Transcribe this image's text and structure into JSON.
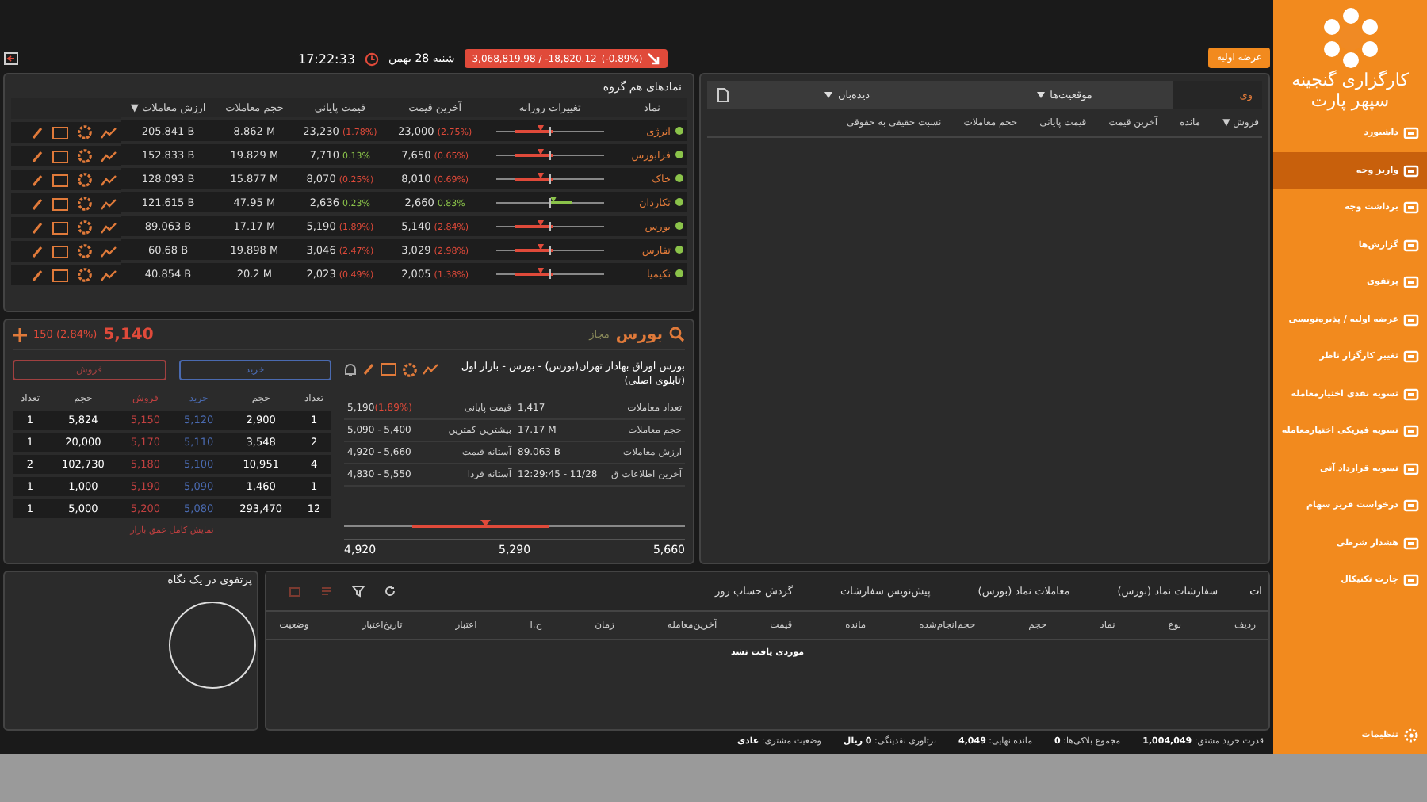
{
  "top_bar": {
    "index": {
      "value": "3,068,819.98 / -18,820.12",
      "pct": "(-0.89%)",
      "up": false
    },
    "date": "شنبه 28 بهمن",
    "time": "17:22:33"
  },
  "ipo_button": "عرضه اولیه",
  "group_table": {
    "title": "نمادهای هم گروه",
    "columns": [
      "نماد",
      "تغییرات روزانه",
      "آخرین قیمت",
      "قیمت پایانی",
      "حجم معاملات",
      "ارزش معاملات ▼"
    ],
    "rows": [
      {
        "symbol": "انرژی",
        "last": "23,000",
        "last_pct": "(2.75%)",
        "last_up": false,
        "close": "23,230",
        "close_pct": "(1.78%)",
        "close_up": false,
        "volume": "8.862 M",
        "value": "205.841 B"
      },
      {
        "symbol": "فرابورس",
        "last": "7,650",
        "last_pct": "(0.65%)",
        "last_up": false,
        "close": "7,710",
        "close_pct": "0.13%",
        "close_up": true,
        "volume": "19.829 M",
        "value": "152.833 B"
      },
      {
        "symbol": "خاک",
        "last": "8,010",
        "last_pct": "(0.69%)",
        "last_up": false,
        "close": "8,070",
        "close_pct": "(0.25%)",
        "close_up": false,
        "volume": "15.877 M",
        "value": "128.093 B"
      },
      {
        "symbol": "تکاردان",
        "last": "2,660",
        "last_pct": "0.83%",
        "last_up": true,
        "close": "2,636",
        "close_pct": "0.23%",
        "close_up": true,
        "volume": "47.95 M",
        "value": "121.615 B"
      },
      {
        "symbol": "بورس",
        "last": "5,140",
        "last_pct": "(2.84%)",
        "last_up": false,
        "close": "5,190",
        "close_pct": "(1.89%)",
        "close_up": false,
        "volume": "17.17 M",
        "value": "89.063 B"
      },
      {
        "symbol": "تفارس",
        "last": "3,029",
        "last_pct": "(2.98%)",
        "last_up": false,
        "close": "3,046",
        "close_pct": "(2.47%)",
        "close_up": false,
        "volume": "19.898 M",
        "value": "60.68 B"
      },
      {
        "symbol": "تکیمیا",
        "last": "2,005",
        "last_pct": "(1.38%)",
        "last_up": false,
        "close": "2,023",
        "close_pct": "(0.49%)",
        "close_up": false,
        "volume": "20.2 M",
        "value": "40.854 B"
      }
    ]
  },
  "symbol_panel": {
    "symbol": "بورس",
    "status": "مجاز",
    "price": "5,140",
    "change": "150 (2.84%)",
    "up": false,
    "full_name": "بورس اوراق بهادار تهران(بورس) - بورس - بازار اول (تابلوی اصلی)",
    "buy_button": "خرید",
    "sell_button": "فروش",
    "info": [
      {
        "label": "تعداد معاملات",
        "value": "1,417"
      },
      {
        "label": "قیمت پایانی",
        "value": "5,190",
        "pct": "(1.89%)"
      },
      {
        "label": "حجم معاملات",
        "value": "17.17 M"
      },
      {
        "label": "بیشترین کمترین",
        "value": "5,090 - 5,400"
      },
      {
        "label": "ارزش معاملات",
        "value": "89.063 B"
      },
      {
        "label": "آستانه قیمت",
        "value": "4,920 - 5,660"
      },
      {
        "label": "آخرین اطلاعات ق",
        "value": "12:29:45 - 11/28"
      },
      {
        "label": "آستانه فردا",
        "value": "4,830 - 5,550"
      }
    ],
    "range": {
      "min": "4,920",
      "mid": "5,290",
      "max": "5,660"
    },
    "book_columns": [
      "تعداد",
      "حجم",
      "خرید",
      "فروش",
      "حجم",
      "تعداد"
    ],
    "book": [
      {
        "buy_count": "1",
        "buy_volume": "2,900",
        "buy_price": "5,120",
        "sell_price": "5,150",
        "sell_volume": "5,824",
        "sell_count": "1"
      },
      {
        "buy_count": "2",
        "buy_volume": "3,548",
        "buy_price": "5,110",
        "sell_price": "5,170",
        "sell_volume": "20,000",
        "sell_count": "1"
      },
      {
        "buy_count": "4",
        "buy_volume": "10,951",
        "buy_price": "5,100",
        "sell_price": "5,180",
        "sell_volume": "102,730",
        "sell_count": "2"
      },
      {
        "buy_count": "1",
        "buy_volume": "1,460",
        "buy_price": "5,090",
        "sell_price": "5,190",
        "sell_volume": "1,000",
        "sell_count": "1"
      },
      {
        "buy_count": "12",
        "buy_volume": "293,470",
        "buy_price": "5,080",
        "sell_price": "5,200",
        "sell_volume": "5,000",
        "sell_count": "1"
      }
    ],
    "depth_link": "نمایش کامل عمق بازار"
  },
  "right_panel": {
    "tabs": [
      {
        "label": "وی",
        "selected": true
      },
      {
        "label": "موقعیت‌ها",
        "selected": false
      },
      {
        "label": "دیده‌بان",
        "selected": false
      }
    ],
    "columns": [
      "فروش ▼",
      "مانده",
      "آخرین قیمت",
      "قیمت پایانی",
      "حجم معاملات",
      "نسبت حقیقی به حقوقی"
    ]
  },
  "portfolio": {
    "title": "پرتفوی در یک نگاه"
  },
  "orders": {
    "tabs": [
      {
        "label": "ات",
        "selected": true
      },
      {
        "label": "سفارشات نماد (بورس)",
        "selected": false
      },
      {
        "label": "معاملات نماد (بورس)",
        "selected": false
      },
      {
        "label": "پیش‌نویس سفارشات",
        "selected": false
      },
      {
        "label": "گردش حساب روز",
        "selected": false
      }
    ],
    "columns": [
      "ردیف",
      "نوع",
      "نماد",
      "حجم",
      "حجم‌انجام‌شده",
      "مانده",
      "قیمت",
      "آخرین‌معامله",
      "زمان",
      "ح.ا",
      "اعتبار",
      "تاریخ‌اعتبار",
      "وضعیت"
    ],
    "empty": "موردی یافت نشد"
  },
  "status_bar": [
    {
      "label": "قدرت خرید مشتق:",
      "value": "1,004,049"
    },
    {
      "label": "مجموع بلاکی‌ها:",
      "value": "0"
    },
    {
      "label": "مانده نهایی:",
      "value": "4,049"
    },
    {
      "label": "برتاوری نقدینگی:",
      "value": "0 ریال"
    },
    {
      "label": "وضعیت مشتری:",
      "value": "عادی"
    }
  ],
  "sidebar": {
    "brand": "کارگزاری گنجینه سپهر پارت",
    "items": [
      {
        "label": "داشبورد",
        "selected": false
      },
      {
        "label": "واریز وجه",
        "selected": true
      },
      {
        "label": "برداشت وجه",
        "selected": false
      },
      {
        "label": "گزارش‌ها",
        "selected": false
      },
      {
        "label": "پرتفوی",
        "selected": false
      },
      {
        "label": "عرضه اولیه / پذیره‌نویسی",
        "selected": false
      },
      {
        "label": "تغییر کارگزار ناظر",
        "selected": false
      },
      {
        "label": "تسویه نقدی اختیارمعامله",
        "selected": false
      },
      {
        "label": "تسویه فیزیکی اختیارمعامله",
        "selected": false
      },
      {
        "label": "تسویه قرارداد آتی",
        "selected": false
      },
      {
        "label": "درخواست فریز سهام",
        "selected": false
      },
      {
        "label": "هشدار شرطی",
        "selected": false
      },
      {
        "label": "چارت تکنیکال",
        "selected": false
      }
    ],
    "settings": "تنظیمات"
  }
}
